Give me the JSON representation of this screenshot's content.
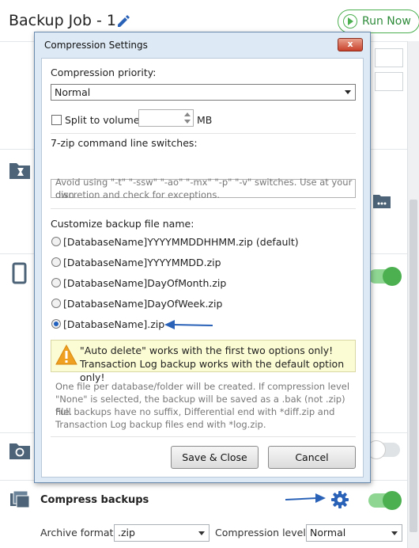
{
  "app": {
    "title": "Backup Job - 1",
    "run_now_label": "Run Now",
    "accent_color": "#4caf50"
  },
  "compress": {
    "label": "Compress backups",
    "archive_format_label": "Archive format:",
    "archive_format_value": ".zip",
    "compression_level_label": "Compression level:",
    "compression_level_value": "Normal"
  },
  "dialog": {
    "title": "Compression Settings",
    "close_label": "x",
    "priority_label": "Compression priority:",
    "priority_value": "Normal",
    "split_label": "Split to volumes:",
    "split_value": "",
    "split_unit": "MB",
    "split_checked": false,
    "switches_label": "7-zip command line switches:",
    "switches_value": "",
    "switches_hint_line1": "Avoid using \"-t\" \"-ssw\" \"-ao\" \"-mx\" \"-p\" \"-v\" switches. Use at your own",
    "switches_hint_line2": "discretion and check for exceptions.",
    "customize_label": "Customize backup file name:",
    "name_options": [
      "[DatabaseName]YYYYMMDDHHMM.zip (default)",
      "[DatabaseName]YYYYMMDD.zip",
      "[DatabaseName]DayOfMonth.zip",
      "[DatabaseName]DayOfWeek.zip",
      "[DatabaseName].zip"
    ],
    "selected_option_index": 4,
    "warning_line1": "\"Auto delete\" works with the first two options only!",
    "warning_line2": "Transaction Log backup works with the default option only!",
    "info_line1": "One file per database/folder will be created. If compression level",
    "info_line2": "\"None\" is selected, the backup will be saved as a .bak (not .zip) file.",
    "info_line3": "Full backups have no suffix, Differential end with *diff.zip and",
    "info_line4": "Transaction Log backup files end with *log.zip.",
    "save_label": "Save & Close",
    "cancel_label": "Cancel"
  },
  "icons": [
    "edit-icon",
    "play-icon",
    "folder-hourglass-icon",
    "folder-dots-icon",
    "phone-icon",
    "folder-restore-icon",
    "compress-icon",
    "gear-icon",
    "warning-icon",
    "arrow-icon"
  ],
  "colors": {
    "arrow": "#2a62b8",
    "toggle_on": "#4caf50",
    "warning_bg": "#fcfcd4"
  }
}
